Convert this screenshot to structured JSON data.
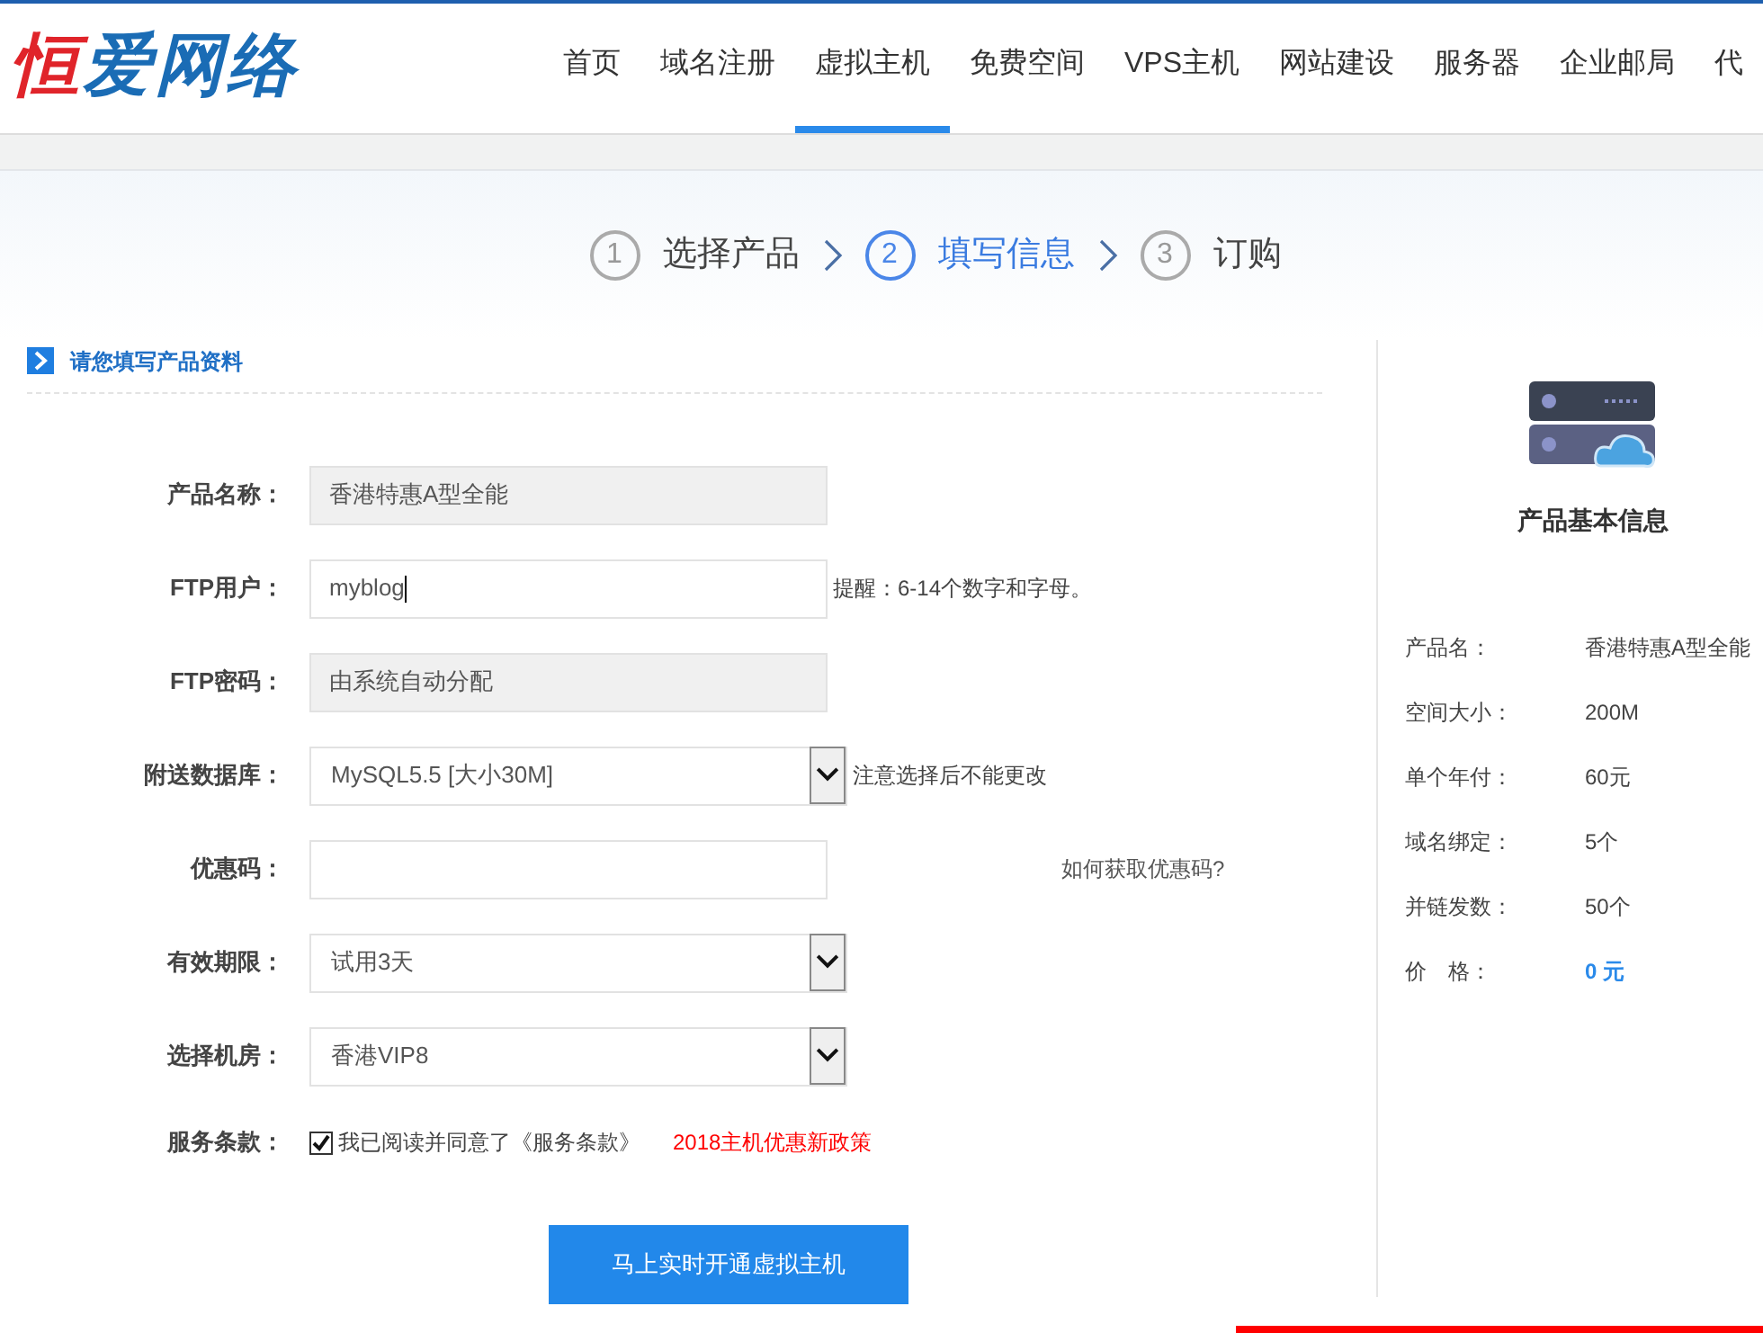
{
  "logo": "恒爱网络",
  "nav": [
    {
      "label": "首页",
      "selected": false
    },
    {
      "label": "域名注册",
      "selected": false
    },
    {
      "label": "虚拟主机",
      "selected": true
    },
    {
      "label": "免费空间",
      "selected": false
    },
    {
      "label": "VPS主机",
      "selected": false
    },
    {
      "label": "网站建设",
      "selected": false
    },
    {
      "label": "服务器",
      "selected": false
    },
    {
      "label": "企业邮局",
      "selected": false
    },
    {
      "label": "代",
      "selected": false
    }
  ],
  "steps": [
    {
      "number": "1",
      "label": "选择产品",
      "selected": false
    },
    {
      "number": "2",
      "label": "填写信息",
      "selected": true
    },
    {
      "number": "3",
      "label": "订购",
      "selected": false
    }
  ],
  "section_title": "请您填写产品资料",
  "form": [
    {
      "kind": "readonly",
      "label": "产品名称：",
      "value": "香港特惠A型全能"
    },
    {
      "kind": "input",
      "label": "FTP用户：",
      "value": "myblog",
      "hint": "提醒：6-14个数字和字母。"
    },
    {
      "kind": "readonly",
      "label": "FTP密码：",
      "value": "由系统自动分配"
    },
    {
      "kind": "select",
      "label": "附送数据库：",
      "value": "MySQL5.5 [大小30M]",
      "hint": "注意选择后不能更改"
    },
    {
      "kind": "coupon",
      "label": "优惠码：",
      "link": "如何获取优惠码?"
    },
    {
      "kind": "select",
      "label": "有效期限：",
      "value": "试用3天"
    },
    {
      "kind": "select",
      "label": "选择机房：",
      "value": "香港VIP8"
    }
  ],
  "terms": {
    "label": "服务条款：",
    "checked": true,
    "text": "我已阅读并同意了《服务条款》",
    "link": "2018主机优惠新政策"
  },
  "submit": "马上实时开通虚拟主机",
  "info": {
    "title": "产品基本信息",
    "rows": [
      {
        "label": "产品名：",
        "value": "香港特惠A型全能",
        "kind": "plain"
      },
      {
        "label": "空间大小：",
        "value": "200M",
        "kind": "plain"
      },
      {
        "label": "单个年付：",
        "value": "60元",
        "kind": "plain"
      },
      {
        "label": "域名绑定：",
        "value": "5个",
        "kind": "plain"
      },
      {
        "label": "并链发数：",
        "value": "50个",
        "kind": "plain"
      },
      {
        "label": "价　格：",
        "value": "0 元",
        "kind": "price"
      }
    ]
  }
}
